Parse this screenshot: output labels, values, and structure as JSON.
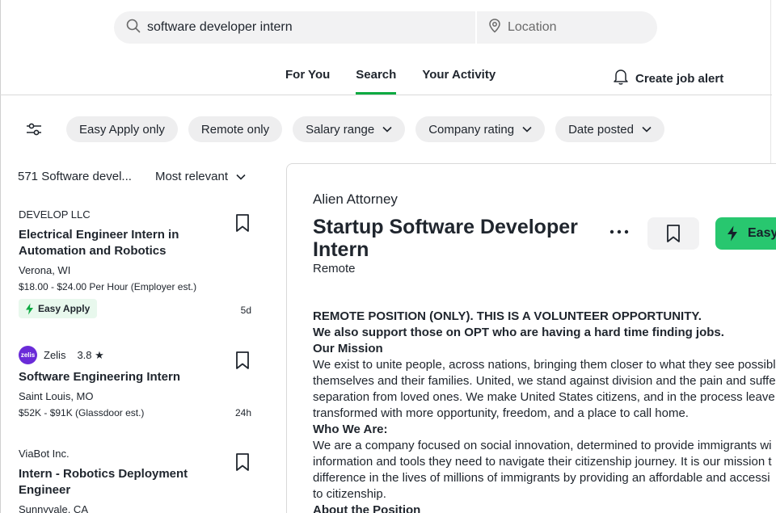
{
  "search": {
    "keyword": "software developer intern",
    "location_placeholder": "Location"
  },
  "tabs": [
    {
      "label": "For You",
      "active": false
    },
    {
      "label": "Search",
      "active": true
    },
    {
      "label": "Your Activity",
      "active": false
    }
  ],
  "alert": {
    "label": "Create job alert"
  },
  "filters": [
    {
      "label": "Easy Apply only",
      "dropdown": false
    },
    {
      "label": "Remote only",
      "dropdown": false
    },
    {
      "label": "Salary range",
      "dropdown": true
    },
    {
      "label": "Company rating",
      "dropdown": true
    },
    {
      "label": "Date posted",
      "dropdown": true
    }
  ],
  "list": {
    "count_label": "571 Software devel...",
    "sort_label": "Most relevant",
    "jobs": [
      {
        "company": "DEVELOP LLC",
        "rating": "",
        "title": "Electrical Engineer Intern in Automation and Robotics",
        "location": "Verona, WI",
        "salary": "$18.00 - $24.00 Per Hour (Employer est.)",
        "badge": "Easy Apply",
        "age": "5d"
      },
      {
        "company": "Zelis",
        "logo_text": "zelis",
        "rating": "3.8 ★",
        "title": "Software Engineering Intern",
        "location": "Saint Louis, MO",
        "salary": "$52K - $91K (Glassdoor est.)",
        "age": "24h"
      },
      {
        "company": "ViaBot Inc.",
        "rating": "",
        "title": "Intern - Robotics Deployment Engineer",
        "location": "Sunnyvale, CA"
      }
    ]
  },
  "detail": {
    "company": "Alien Attorney",
    "title": "Startup Software Developer Intern",
    "location": "Remote",
    "apply_label": "Easy",
    "description": {
      "line1": "REMOTE POSITION (ONLY). THIS IS A VOLUNTEER OPPORTUNITY.",
      "line2": "We also support those on OPT who are having a hard time finding jobs.",
      "mission_heading": "Our Mission",
      "mission_1": "We exist to unite people, across nations, bringing them closer to what they see possibl",
      "mission_2": "themselves and their families. United, we stand against division and the pain and suffe",
      "mission_3": "separation from loved ones. We make United States citizens, and in the process leave",
      "mission_4": "transformed with more opportunity, freedom, and a place to call home.",
      "who_heading": "Who We Are:",
      "who_1": "We are a company focused on social innovation, determined to provide immigrants wi",
      "who_2": "information and tools they need to navigate their citizenship journey. It is our mission t",
      "who_3": "difference in the lives of millions of immigrants by providing an affordable and accessi",
      "who_4": "to citizenship.",
      "position_heading": "About the Position"
    }
  },
  "colors": {
    "accent": "#0caa41",
    "apply": "#28c76f",
    "badge_bg": "#e8f8ed",
    "chip_bg": "#eeeeef"
  }
}
